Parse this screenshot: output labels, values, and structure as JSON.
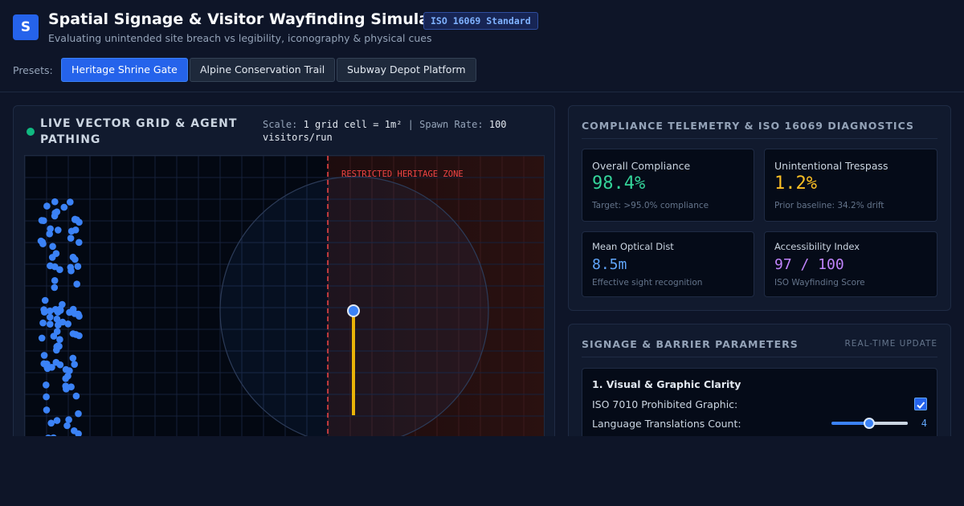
{
  "header": {
    "logo_letter": "S",
    "title": "Spatial Signage & Visitor Wayfinding Simulator",
    "badge": "ISO 16069 Standard",
    "subtitle": "Evaluating unintended site breach vs legibility, iconography & physical cues"
  },
  "presets": {
    "label": "Presets:",
    "items": [
      {
        "label": "Heritage Shrine Gate",
        "active": true
      },
      {
        "label": "Alpine Conservation Trail",
        "active": false
      },
      {
        "label": "Subway Depot Platform",
        "active": false
      }
    ]
  },
  "grid_panel": {
    "title": "LIVE VECTOR GRID & AGENT PATHING",
    "scale_label": "Scale:",
    "scale_value": "1 grid cell = 1m²",
    "separator": "|",
    "spawn_label": "Spawn Rate:",
    "spawn_value": "100 visitors/run",
    "zone_label": "RESTRICTED HERITAGE ZONE"
  },
  "telemetry": {
    "title": "COMPLIANCE TELEMETRY & ISO 16069 DIAGNOSTICS",
    "cards": [
      {
        "label": "Overall Compliance",
        "value": "98.4%",
        "note": "Target: >95.0% compliance",
        "color": "#34d399"
      },
      {
        "label": "Unintentional Trespass",
        "value": "1.2%",
        "note": "Prior baseline: 34.2% drift",
        "color": "#fbbf24"
      },
      {
        "label": "Mean Optical Dist",
        "value": "8.5m",
        "note": "Effective sight recognition",
        "color": "#60a5fa"
      },
      {
        "label": "Accessibility Index",
        "value": "97 / 100",
        "note": "ISO Wayfinding Score",
        "color": "#c084fc"
      }
    ]
  },
  "parameters": {
    "title": "SIGNAGE & BARRIER PARAMETERS",
    "tag": "REAL-TIME UPDATE",
    "section": {
      "title": "1. Visual & Graphic Clarity",
      "checkbox_label": "ISO 7010 Prohibited Graphic:",
      "checkbox_checked": true,
      "slider_label": "Language Translations Count:",
      "slider_value": "4"
    }
  },
  "colors": {
    "accent": "#2563eb",
    "agent": "#3b82f6",
    "barrier": "#ef4444",
    "path": "#eab308"
  }
}
